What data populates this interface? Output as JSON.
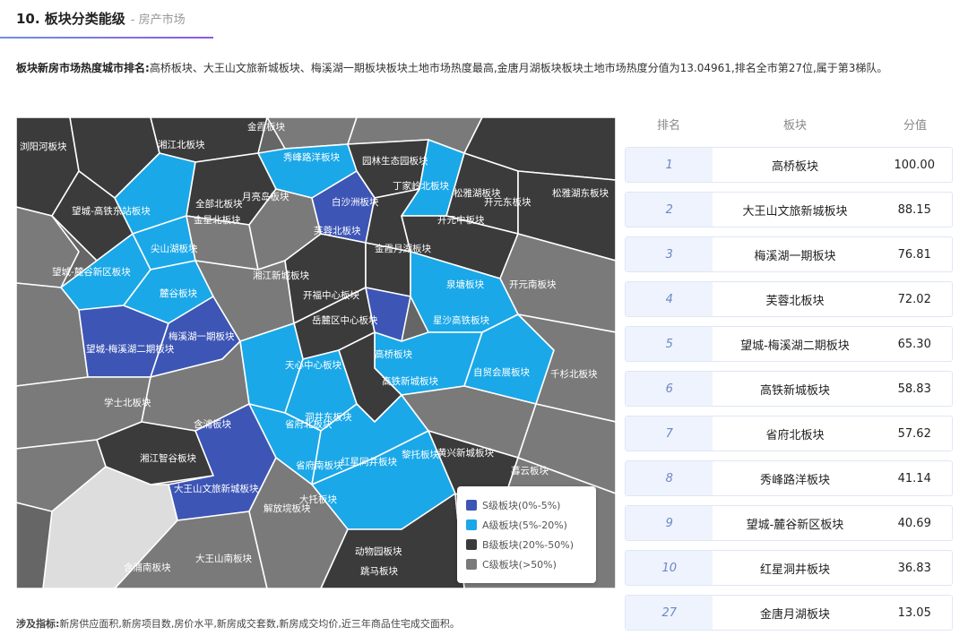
{
  "header": {
    "title": "10. 板块分类能级",
    "subtitle": "- 房产市场"
  },
  "summary": {
    "label": "板块新房市场热度城市排名:",
    "text": "高桥板块、大王山文旅新城板块、梅溪湖一期板块板块土地市场热度最高,金唐月湖板块板块土地市场热度分值为13.04961,排名全市第27位,属于第3梯队。"
  },
  "colors": {
    "S": "#3d55b5",
    "A": "#1aa8e8",
    "B": "#3b3b3b",
    "C": "#7a7a7a",
    "accent": "#6f86c7"
  },
  "map": {
    "labels": [
      "金霞板块",
      "湘江北板块",
      "浏阳河板块",
      "秀峰路洋板块",
      "园林生态园板块",
      "丁家岭北板块",
      "松雅湖板块",
      "开元东板块",
      "松雅湖东板块",
      "望城-高铁东站板块",
      "全部北板块",
      "月亮岛板块",
      "芙蓉北板块",
      "白沙洲板块",
      "开元中板块",
      "金霞月湖板块",
      "麓谷板块",
      "望城-麓谷新区板块",
      "金星北板块",
      "尖山湖板块",
      "湘江新城板块",
      "开福中心板块",
      "梅溪湖一期板块",
      "泉塘板块",
      "开元南板块",
      "望城-梅溪湖二期板块",
      "岳麓区中心板块",
      "高桥板块",
      "天心中心板块",
      "星沙高铁板块",
      "自贸会展板块",
      "高铁新城板块",
      "学士北板块",
      "省府北板块",
      "洞井东板块",
      "含浦板块",
      "湘江智谷板块",
      "大王山文旅新城板块",
      "省府南板块",
      "红星同井板块",
      "暮云板块",
      "大托板块",
      "黎托板块",
      "黄兴新城板块",
      "解放垸板块",
      "大王山南板块",
      "含浦南板块",
      "动物园板块",
      "跳马板块",
      "千杉北板块"
    ]
  },
  "legend": [
    {
      "key": "S",
      "label": "S级板块(0%-5%)",
      "color": "#3d55b5"
    },
    {
      "key": "A",
      "label": "A级板块(5%-20%)",
      "color": "#1aa8e8"
    },
    {
      "key": "B",
      "label": "B级板块(20%-50%)",
      "color": "#3b3b3b"
    },
    {
      "key": "C",
      "label": "C级板块(>50%)",
      "color": "#7a7a7a"
    }
  ],
  "table": {
    "headers": {
      "rank": "排名",
      "name": "板块",
      "score": "分值"
    },
    "rows": [
      {
        "rank": "1",
        "name": "高桥板块",
        "score": "100.00"
      },
      {
        "rank": "2",
        "name": "大王山文旅新城板块",
        "score": "88.15"
      },
      {
        "rank": "3",
        "name": "梅溪湖一期板块",
        "score": "76.81"
      },
      {
        "rank": "4",
        "name": "芙蓉北板块",
        "score": "72.02"
      },
      {
        "rank": "5",
        "name": "望城-梅溪湖二期板块",
        "score": "65.30"
      },
      {
        "rank": "6",
        "name": "高铁新城板块",
        "score": "58.83"
      },
      {
        "rank": "7",
        "name": "省府北板块",
        "score": "57.62"
      },
      {
        "rank": "8",
        "name": "秀峰路洋板块",
        "score": "41.14"
      },
      {
        "rank": "9",
        "name": "望城-麓谷新区板块",
        "score": "40.69"
      },
      {
        "rank": "10",
        "name": "红星洞井板块",
        "score": "36.83"
      },
      {
        "rank": "27",
        "name": "金唐月湖板块",
        "score": "13.05"
      }
    ]
  },
  "note": {
    "label": "涉及指标:",
    "text": "新房供应面积,新房项目数,房价水平,新房成交套数,新房成交均价,近三年商品住宅成交面积。"
  }
}
